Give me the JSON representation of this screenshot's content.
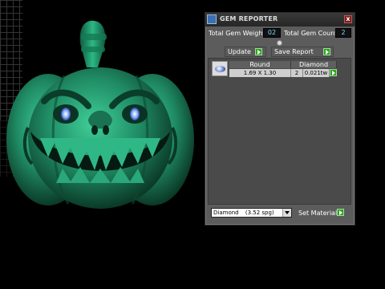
{
  "panel": {
    "title": "GEM REPORTER",
    "close_glyph": "x",
    "total_weight_label": "Total Gem Weight",
    "total_weight_value": "02",
    "total_count_label": "Total Gem Count",
    "total_count_value": "2",
    "update_label": "Update",
    "save_report_label": "Save Report",
    "table": {
      "headers": [
        "Round",
        "Diamond"
      ],
      "row": {
        "size": "1.69 X 1.30",
        "count": "2",
        "weight": "0.021tw"
      }
    },
    "material_select": {
      "selected": "Diamond",
      "spg": "(3.52 spg)"
    },
    "set_material_label": "Set Material"
  },
  "colors": {
    "model_green": "#1f8a63",
    "panel_bg": "#5c5c5c",
    "go_green": "#33a020",
    "field_text": "#7fd8ff"
  },
  "icons": {
    "title_icon": "gem-reporter-icon",
    "close": "close-icon",
    "go": "play-arrow-icon"
  }
}
